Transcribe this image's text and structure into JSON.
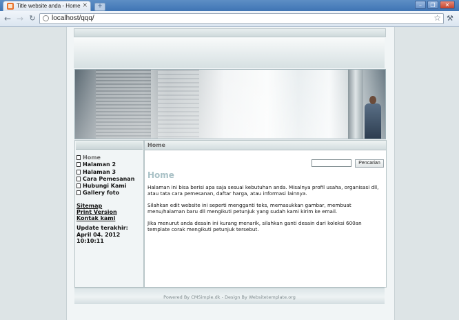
{
  "browser": {
    "tab_title": "Title website anda - Home",
    "url": "localhost/qqq/",
    "tab_close": "×",
    "new_tab": "+",
    "window_buttons": [
      "–",
      "❐",
      "✕"
    ],
    "back": "←",
    "forward": "→",
    "star": "☆",
    "wrench": "🔧"
  },
  "sidebar": {
    "menu": [
      {
        "label": "Home",
        "active": true
      },
      {
        "label": "Halaman 2",
        "active": false
      },
      {
        "label": "Halaman 3",
        "active": false
      },
      {
        "label": "Cara Pemesanan",
        "active": false
      },
      {
        "label": "Hubungi Kami",
        "active": false
      },
      {
        "label": "Gallery foto",
        "active": false
      }
    ],
    "links": [
      "Sitemap",
      "Print Version",
      "Kontak kami"
    ],
    "updated_label": "Update terakhir:",
    "updated_date": "April 04. 2012",
    "updated_time": "10:10:11"
  },
  "main": {
    "breadcrumb": "Home",
    "search_button": "Pencarian",
    "title": "Home",
    "paragraphs": [
      "Halaman ini bisa berisi apa saja sesuai kebutuhan anda. Misalnya profil usaha, organisasi dll, atau tata cara pemesanan, daftar harga, atau informasi lainnya.",
      "Silahkan edit website ini seperti mengganti teks, memasukkan gambar, membuat menu/halaman baru dll mengikuti petunjuk yang sudah kami kirim ke email.",
      "Jika menurut anda desain ini kurang menarik, silahkan ganti desain dari koleksi 600an template corak mengikuti petunjuk tersebut."
    ]
  },
  "footer": {
    "text": "Powered By CMSimple.dk - Design By Websitetemplate.org"
  }
}
